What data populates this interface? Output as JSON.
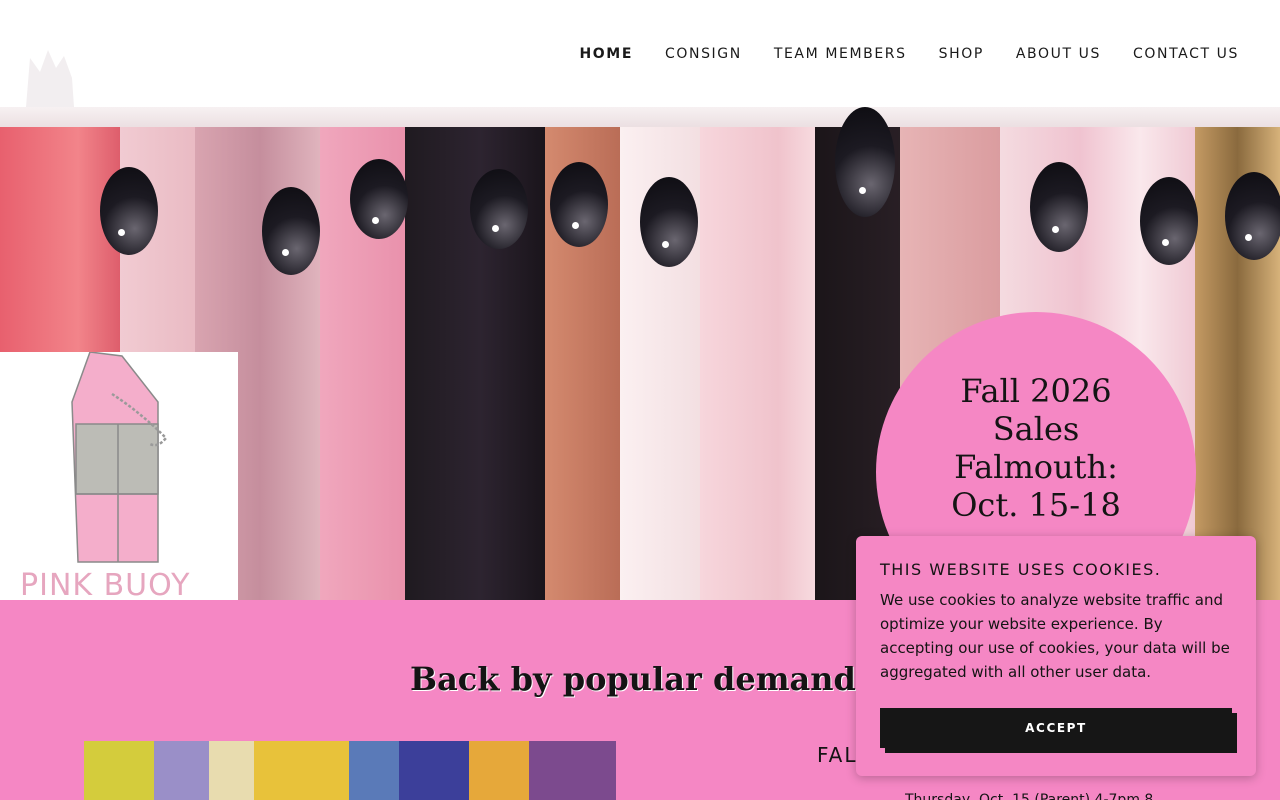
{
  "nav": {
    "items": [
      {
        "label": "HOME",
        "active": true
      },
      {
        "label": "CONSIGN"
      },
      {
        "label": "TEAM MEMBERS"
      },
      {
        "label": "SHOP"
      },
      {
        "label": "ABOUT US"
      },
      {
        "label": "CONTACT US"
      }
    ]
  },
  "hero": {
    "logo_text": "PINK BUOY",
    "circle_text": "Fall 2026 Sales Falmouth: Oct. 15-18"
  },
  "section": {
    "title": "Back by popular demand!",
    "sub_heading": "FAL",
    "sub_text": "Thursday, Oct. 15 (Parent) 4-7pm 8"
  },
  "cookie": {
    "title": "THIS WEBSITE USES COOKIES.",
    "body": "We use cookies to analyze website traffic and optimize your website experience. By accepting our use of cookies, your data will be aggregated with all other user data.",
    "accept_label": "ACCEPT"
  },
  "colors": {
    "accent": "#f587c4",
    "button": "#161616"
  }
}
